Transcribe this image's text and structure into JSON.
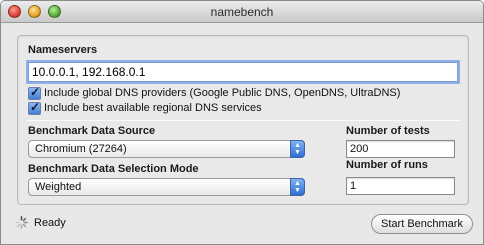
{
  "window": {
    "title": "namebench"
  },
  "nameservers": {
    "label": "Nameservers",
    "value": "10.0.0.1, 192.168.0.1"
  },
  "options": [
    {
      "label": "Include global DNS providers (Google Public DNS, OpenDNS, UltraDNS)",
      "checked": true
    },
    {
      "label": "Include best available regional DNS services",
      "checked": true
    }
  ],
  "data_source": {
    "label": "Benchmark Data Source",
    "selected": "Chromium (27264)"
  },
  "selection_mode": {
    "label": "Benchmark Data Selection Mode",
    "selected": "Weighted"
  },
  "num_tests": {
    "label": "Number of tests",
    "value": "200"
  },
  "num_runs": {
    "label": "Number of runs",
    "value": "1"
  },
  "status": {
    "text": "Ready",
    "icon": "spinner-icon"
  },
  "start_button": {
    "label": "Start Benchmark"
  },
  "colors": {
    "accent": "#3f7fd9",
    "focus_ring": "#8fb1e8"
  }
}
